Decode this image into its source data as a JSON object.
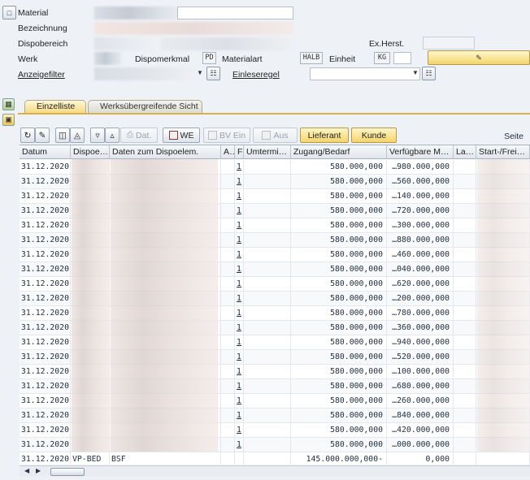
{
  "header": {
    "material_label": "Material",
    "bezeichnung_label": "Bezeichnung",
    "dispobereich_label": "Dispobereich",
    "exherst_label": "Ex.Herst.",
    "werk_label": "Werk",
    "dispomerkmal_label": "Dispomerkmal",
    "dispomerkmal_value": "PD",
    "materialart_label": "Materialart",
    "materialart_value": "HALB",
    "einheit_label": "Einheit",
    "einheit_value": "KG",
    "anzeigefilter_label": "Anzeigefilter",
    "einleseregel_label": "Einleseregel"
  },
  "tabs": [
    "Einzelliste",
    "Werksübergreifende Sicht"
  ],
  "toolbar": {
    "dat_label": "Dat.",
    "we_label": "WE",
    "bv_ein_label": "BV Ein",
    "aus_label": "Aus",
    "lieferant_label": "Lieferant",
    "kunde_label": "Kunde",
    "seite_label": "Seite"
  },
  "table": {
    "columns": [
      "Datum",
      "Dispoe…",
      "Daten zum Dispoelem.",
      "A…",
      "F",
      "Umtermi…",
      "Zugang/Bedarf",
      "Verfügbare M…",
      "La…",
      "Start-/Frei…"
    ],
    "rows": [
      {
        "datum": "31.12.2020",
        "dispo": "",
        "daten": "",
        "f": "1",
        "zugang": "580.000,000",
        "verf": "…980.000,000"
      },
      {
        "datum": "31.12.2020",
        "dispo": "",
        "daten": "",
        "f": "1",
        "zugang": "580.000,000",
        "verf": "…560.000,000"
      },
      {
        "datum": "31.12.2020",
        "dispo": "",
        "daten": "",
        "f": "1",
        "zugang": "580.000,000",
        "verf": "…140.000,000"
      },
      {
        "datum": "31.12.2020",
        "dispo": "",
        "daten": "",
        "f": "1",
        "zugang": "580.000,000",
        "verf": "…720.000,000"
      },
      {
        "datum": "31.12.2020",
        "dispo": "",
        "daten": "",
        "f": "1",
        "zugang": "580.000,000",
        "verf": "…300.000,000"
      },
      {
        "datum": "31.12.2020",
        "dispo": "",
        "daten": "",
        "f": "1",
        "zugang": "580.000,000",
        "verf": "…880.000,000"
      },
      {
        "datum": "31.12.2020",
        "dispo": "",
        "daten": "",
        "f": "1",
        "zugang": "580.000,000",
        "verf": "…460.000,000"
      },
      {
        "datum": "31.12.2020",
        "dispo": "",
        "daten": "",
        "f": "1",
        "zugang": "580.000,000",
        "verf": "…040.000,000"
      },
      {
        "datum": "31.12.2020",
        "dispo": "",
        "daten": "",
        "f": "1",
        "zugang": "580.000,000",
        "verf": "…620.000,000"
      },
      {
        "datum": "31.12.2020",
        "dispo": "",
        "daten": "",
        "f": "1",
        "zugang": "580.000,000",
        "verf": "…200.000,000"
      },
      {
        "datum": "31.12.2020",
        "dispo": "",
        "daten": "",
        "f": "1",
        "zugang": "580.000,000",
        "verf": "…780.000,000"
      },
      {
        "datum": "31.12.2020",
        "dispo": "",
        "daten": "",
        "f": "1",
        "zugang": "580.000,000",
        "verf": "…360.000,000"
      },
      {
        "datum": "31.12.2020",
        "dispo": "",
        "daten": "",
        "f": "1",
        "zugang": "580.000,000",
        "verf": "…940.000,000"
      },
      {
        "datum": "31.12.2020",
        "dispo": "",
        "daten": "",
        "f": "1",
        "zugang": "580.000,000",
        "verf": "…520.000,000"
      },
      {
        "datum": "31.12.2020",
        "dispo": "",
        "daten": "",
        "f": "1",
        "zugang": "580.000,000",
        "verf": "…100.000,000"
      },
      {
        "datum": "31.12.2020",
        "dispo": "",
        "daten": "",
        "f": "1",
        "zugang": "580.000,000",
        "verf": "…680.000,000"
      },
      {
        "datum": "31.12.2020",
        "dispo": "",
        "daten": "",
        "f": "1",
        "zugang": "580.000,000",
        "verf": "…260.000,000"
      },
      {
        "datum": "31.12.2020",
        "dispo": "",
        "daten": "",
        "f": "1",
        "zugang": "580.000,000",
        "verf": "…840.000,000"
      },
      {
        "datum": "31.12.2020",
        "dispo": "",
        "daten": "",
        "f": "1",
        "zugang": "580.000,000",
        "verf": "…420.000,000"
      },
      {
        "datum": "31.12.2020",
        "dispo": "",
        "daten": "",
        "f": "1",
        "zugang": "580.000,000",
        "verf": "…000.000,000"
      },
      {
        "datum": "31.12.2020",
        "dispo": "VP-BED",
        "daten": "BSF",
        "f": "",
        "zugang": "145.000.000,000-",
        "verf": "0,000"
      }
    ]
  }
}
